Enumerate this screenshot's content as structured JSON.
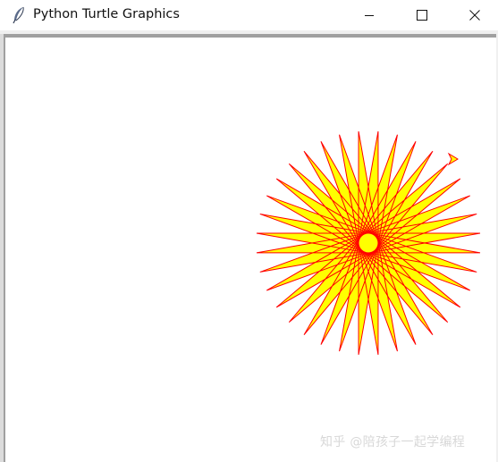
{
  "window": {
    "title": "Python Turtle Graphics",
    "app_icon": "feather-icon"
  },
  "controls": {
    "minimize_icon": "minimize-icon",
    "maximize_icon": "maximize-icon",
    "close_icon": "close-icon"
  },
  "drawing": {
    "shape": "star",
    "points": 36,
    "pen_color": "#ff0000",
    "fill_color": "#ffff00",
    "cursor_icon": "turtle-arrow-icon"
  },
  "watermark": {
    "text": "知乎 @陪孩子一起学编程"
  }
}
